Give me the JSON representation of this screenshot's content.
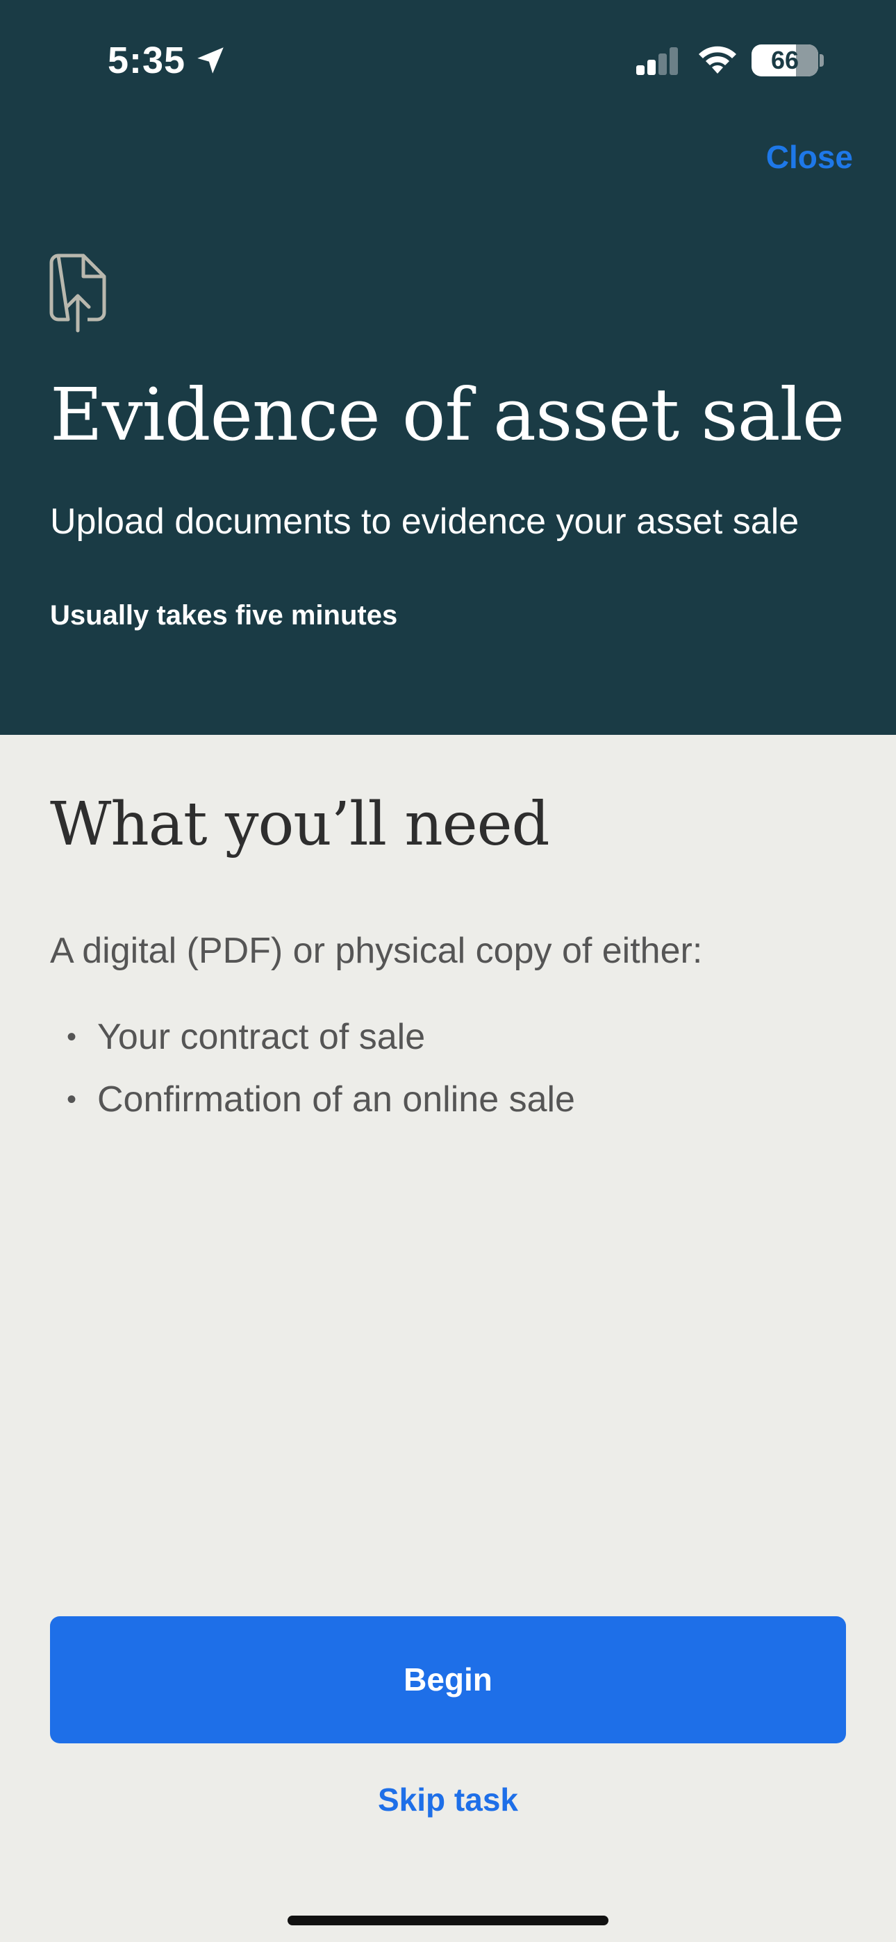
{
  "status_bar": {
    "time": "5:35",
    "battery_level": "66",
    "icons": [
      "location-arrow-icon",
      "signal-icon",
      "wifi-icon",
      "battery-icon"
    ]
  },
  "header": {
    "close_label": "Close",
    "icon": "file-upload-icon",
    "title": "Evidence of asset sale",
    "subtitle": "Upload documents to evidence your asset sale",
    "duration": "Usually takes five minutes"
  },
  "needs": {
    "heading": "What you’ll need",
    "intro": "A digital (PDF) or physical copy of either:",
    "items": [
      "Your contract of sale",
      "Confirmation of an online sale"
    ]
  },
  "actions": {
    "begin_label": "Begin",
    "skip_label": "Skip task"
  },
  "colors": {
    "header_bg": "#1A3B45",
    "page_bg": "#EDEDE9",
    "accent": "#1E6FE8"
  }
}
